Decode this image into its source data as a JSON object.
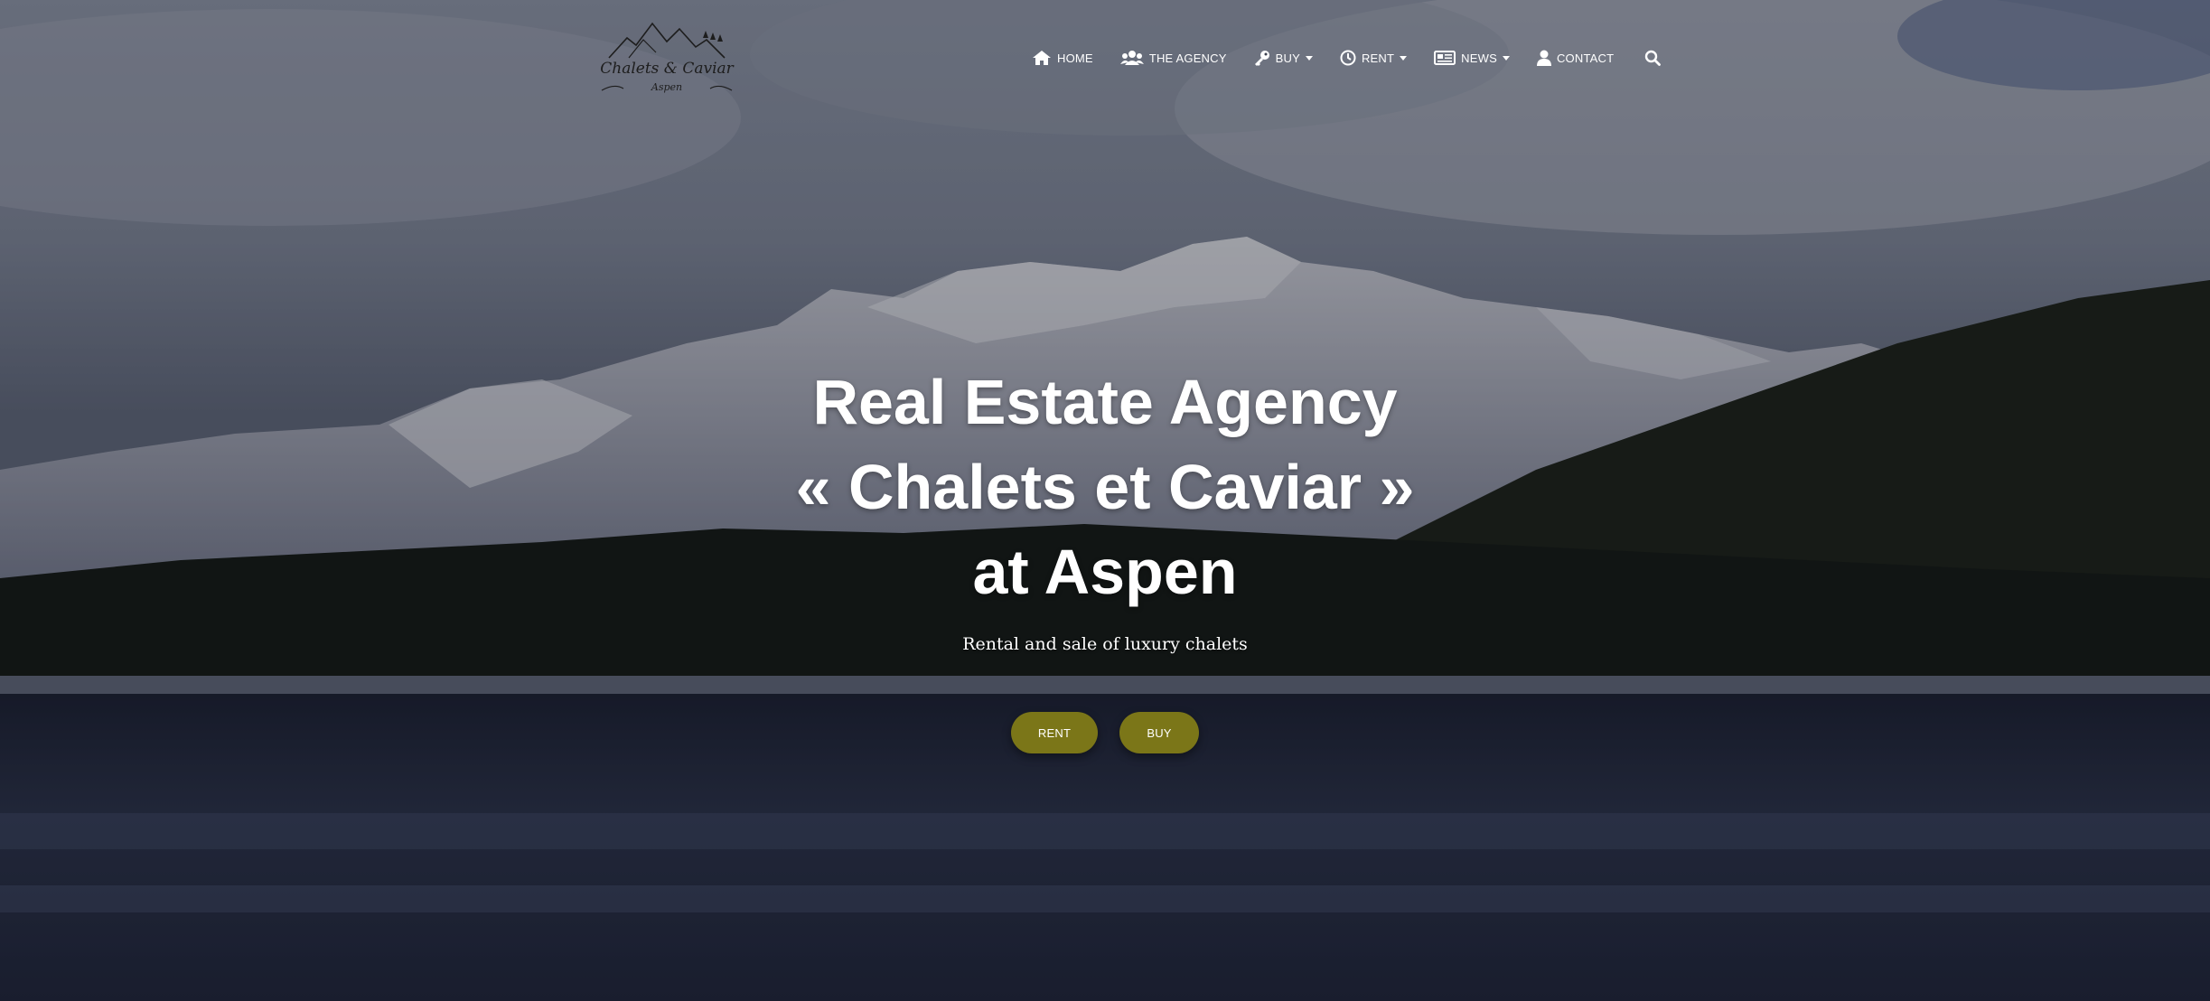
{
  "logo": {
    "name": "Chalets & Caviar",
    "location": "Aspen"
  },
  "nav": {
    "home": "HOME",
    "agency": "THE AGENCY",
    "buy": "BUY",
    "rent": "RENT",
    "news": "NEWS",
    "contact": "CONTACT"
  },
  "icons": {
    "home": "home-icon",
    "agency": "users-icon",
    "buy": "key-icon",
    "rent": "clock-icon",
    "news": "newspaper-icon",
    "contact": "user-icon",
    "search": "search-icon"
  },
  "hero": {
    "title_line1": "Real Estate Agency",
    "title_line2": "« Chalets et Caviar »",
    "title_line3": "at Aspen",
    "subtitle": "Rental and sale of luxury chalets",
    "rent_button": "RENT",
    "buy_button": "BUY"
  },
  "colors": {
    "button": "#7b7618",
    "text": "#ffffff"
  }
}
